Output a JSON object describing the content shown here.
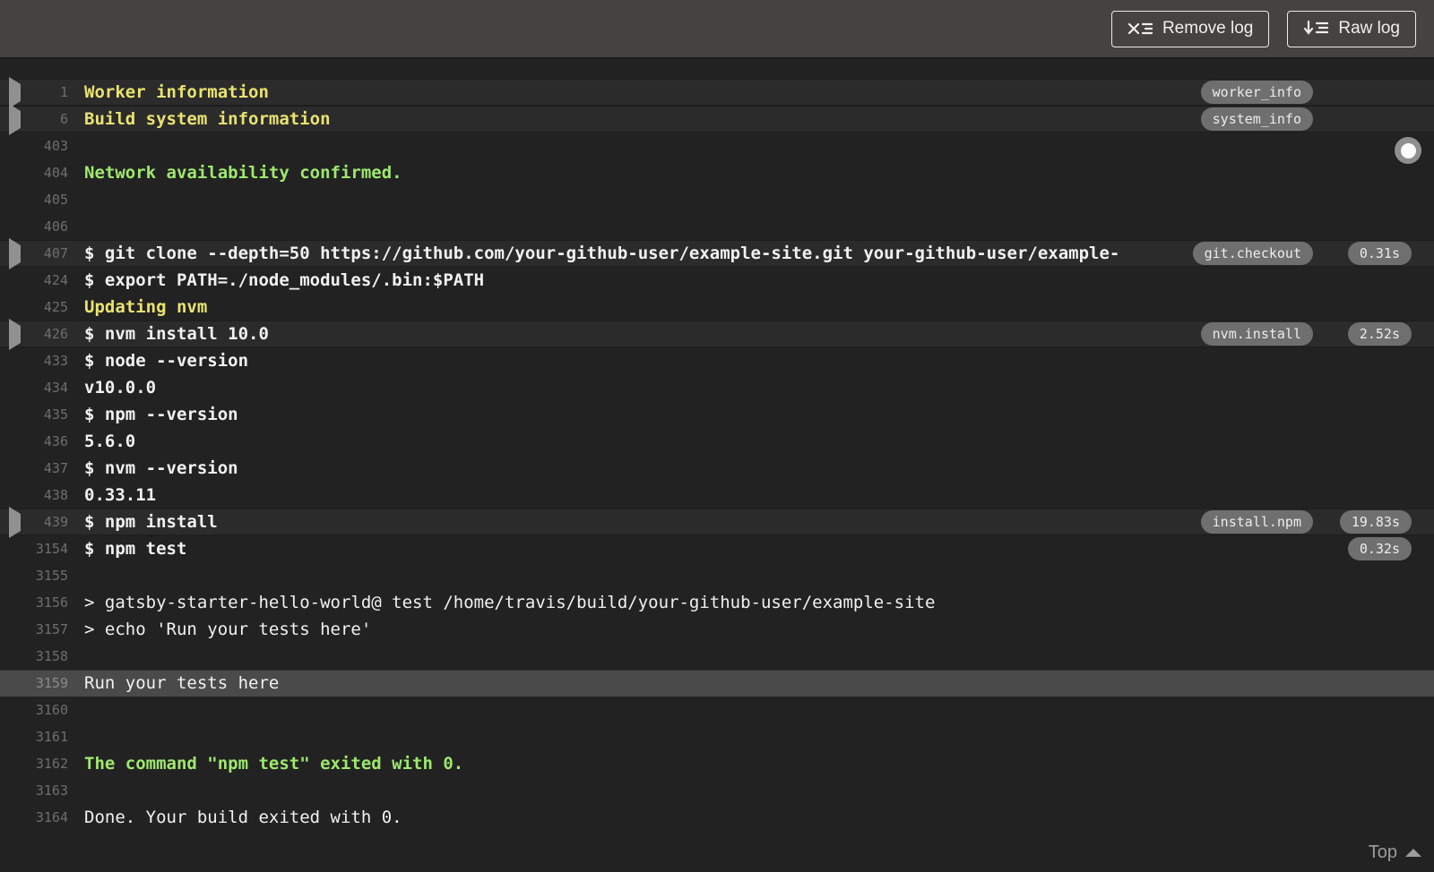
{
  "toolbar": {
    "remove_log_label": "Remove log",
    "raw_log_label": "Raw log"
  },
  "footer": {
    "top_label": "Top"
  },
  "icons": {
    "remove_log": "x-list-icon",
    "raw_log": "download-list-icon",
    "fold": "caret-right-icon",
    "top": "caret-up-icon",
    "scroll_marker": "scroll-position-dot"
  },
  "colors": {
    "toolbar_bg": "#454240",
    "log_bg": "#222222",
    "fold_header_bg": "#2b2b2b",
    "highlight_row_bg": "#4a4a4a",
    "ansi_yellow": "#e9e370",
    "ansi_green": "#9fe86e",
    "badge_bg": "#6f6f6f",
    "line_number": "#6e6e6e",
    "text": "#f1f1f1"
  },
  "log": {
    "rows": [
      {
        "num": "1",
        "text": "Worker information",
        "style": "yellow",
        "fold": true,
        "header": true,
        "tag": "worker_info"
      },
      {
        "num": "6",
        "text": "Build system information",
        "style": "yellow",
        "fold": true,
        "header": true,
        "tag": "system_info"
      },
      {
        "num": "403",
        "text": ""
      },
      {
        "num": "404",
        "text": "Network availability confirmed.",
        "style": "green"
      },
      {
        "num": "405",
        "text": ""
      },
      {
        "num": "406",
        "text": ""
      },
      {
        "num": "407",
        "text": "$ git clone --depth=50 https://github.com/your-github-user/example-site.git your-github-user/example-",
        "style": "command",
        "fold": true,
        "header": true,
        "tag": "git.checkout",
        "duration": "0.31s"
      },
      {
        "num": "424",
        "text": "$ export PATH=./node_modules/.bin:$PATH",
        "style": "command"
      },
      {
        "num": "425",
        "text": "Updating nvm",
        "style": "yellow"
      },
      {
        "num": "426",
        "text": "$ nvm install 10.0",
        "style": "command",
        "fold": true,
        "header": true,
        "tag": "nvm.install",
        "duration": "2.52s"
      },
      {
        "num": "433",
        "text": "$ node --version",
        "style": "command"
      },
      {
        "num": "434",
        "text": "v10.0.0",
        "style": "output-bold"
      },
      {
        "num": "435",
        "text": "$ npm --version",
        "style": "command"
      },
      {
        "num": "436",
        "text": "5.6.0",
        "style": "output-bold"
      },
      {
        "num": "437",
        "text": "$ nvm --version",
        "style": "command"
      },
      {
        "num": "438",
        "text": "0.33.11",
        "style": "output-bold"
      },
      {
        "num": "439",
        "text": "$ npm install",
        "style": "command",
        "fold": true,
        "header": true,
        "tag": "install.npm",
        "duration": "19.83s"
      },
      {
        "num": "3154",
        "text": "$ npm test",
        "style": "command",
        "duration": "0.32s"
      },
      {
        "num": "3155",
        "text": ""
      },
      {
        "num": "3156",
        "text": "> gatsby-starter-hello-world@ test /home/travis/build/your-github-user/example-site"
      },
      {
        "num": "3157",
        "text": "> echo 'Run your tests here'"
      },
      {
        "num": "3158",
        "text": ""
      },
      {
        "num": "3159",
        "text": "Run your tests here",
        "highlight": true
      },
      {
        "num": "3160",
        "text": ""
      },
      {
        "num": "3161",
        "text": ""
      },
      {
        "num": "3162",
        "text": "The command \"npm test\" exited with 0.",
        "style": "green"
      },
      {
        "num": "3163",
        "text": ""
      },
      {
        "num": "3164",
        "text": "Done. Your build exited with 0."
      }
    ]
  }
}
